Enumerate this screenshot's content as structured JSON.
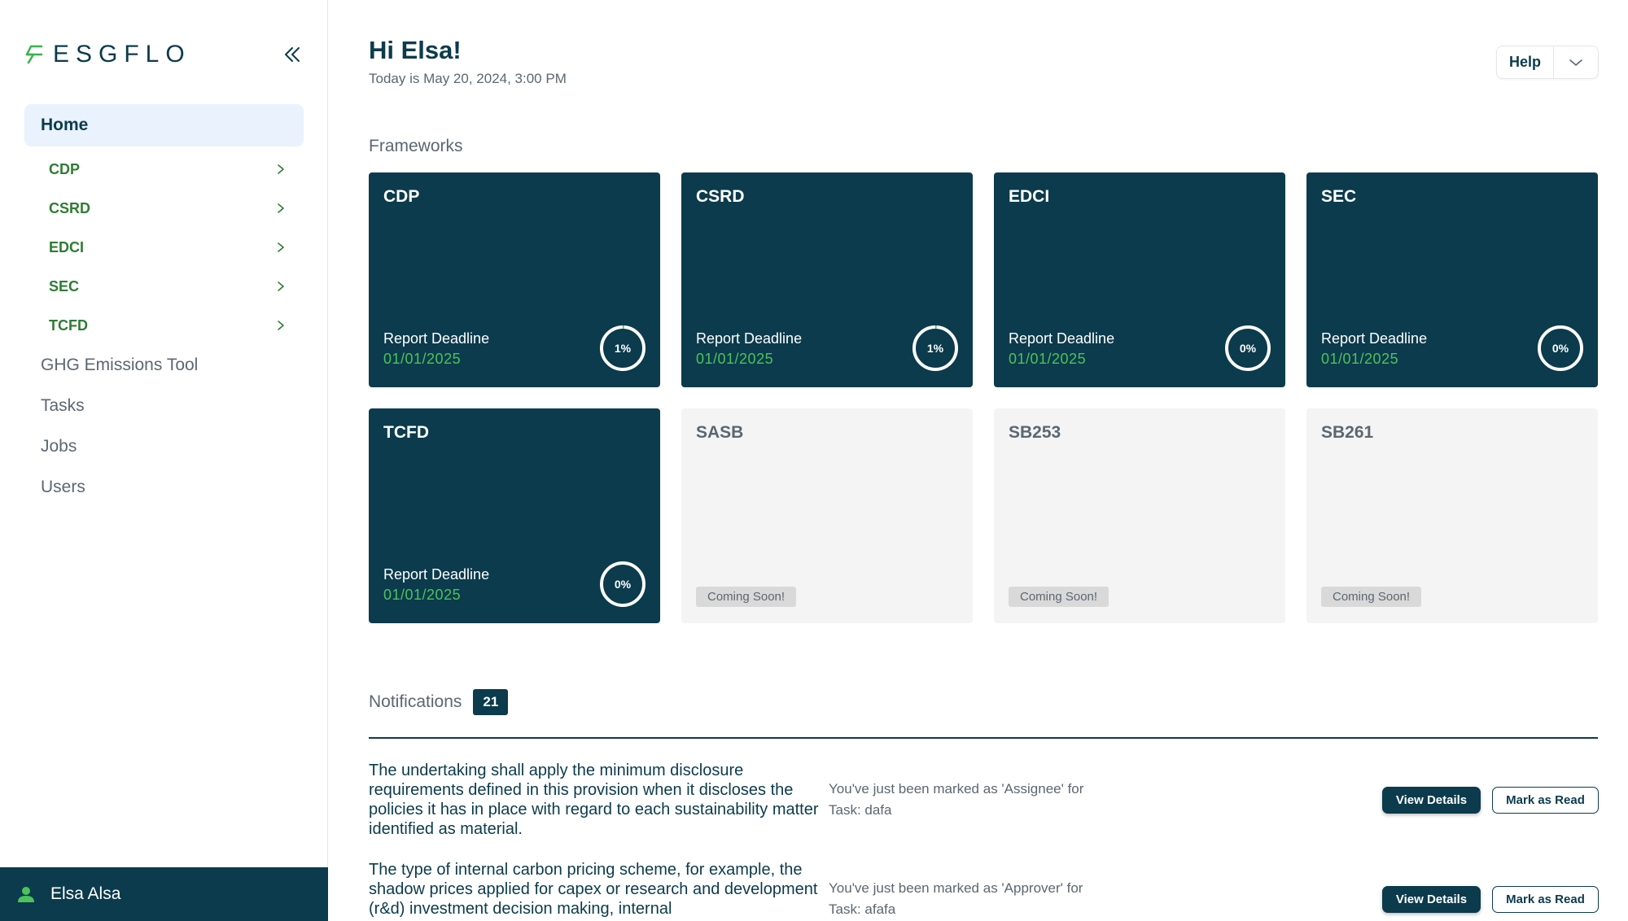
{
  "brand": {
    "logo_text": "ESGFLO",
    "colors": {
      "primary": "#0b3b4c",
      "accent_green": "#37b34a",
      "deadline_green": "#4cc35a",
      "nav_active_bg": "#e9f2fd"
    }
  },
  "sidebar": {
    "home_label": "Home",
    "frameworks": [
      {
        "label": "CDP"
      },
      {
        "label": "CSRD"
      },
      {
        "label": "EDCI"
      },
      {
        "label": "SEC"
      },
      {
        "label": "TCFD"
      }
    ],
    "items": [
      {
        "label": "GHG Emissions Tool"
      },
      {
        "label": "Tasks"
      },
      {
        "label": "Jobs"
      },
      {
        "label": "Users"
      }
    ],
    "user": {
      "name": "Elsa Alsa",
      "icon": "user-icon"
    }
  },
  "header": {
    "greeting": "Hi Elsa!",
    "date": "Today is May 20, 2024, 3:00 PM",
    "help_label": "Help"
  },
  "frameworks": {
    "title": "Frameworks",
    "cards": [
      {
        "name": "CDP",
        "deadline_label": "Report Deadline",
        "deadline": "01/01/2025",
        "progress": 1,
        "progress_label": "1%",
        "status": "active"
      },
      {
        "name": "CSRD",
        "deadline_label": "Report Deadline",
        "deadline": "01/01/2025",
        "progress": 1,
        "progress_label": "1%",
        "status": "active"
      },
      {
        "name": "EDCI",
        "deadline_label": "Report Deadline",
        "deadline": "01/01/2025",
        "progress": 0,
        "progress_label": "0%",
        "status": "active"
      },
      {
        "name": "SEC",
        "deadline_label": "Report Deadline",
        "deadline": "01/01/2025",
        "progress": 0,
        "progress_label": "0%",
        "status": "active"
      },
      {
        "name": "TCFD",
        "deadline_label": "Report Deadline",
        "deadline": "01/01/2025",
        "progress": 0,
        "progress_label": "0%",
        "status": "active"
      },
      {
        "name": "SASB",
        "badge": "Coming Soon!",
        "status": "soon"
      },
      {
        "name": "SB253",
        "badge": "Coming Soon!",
        "status": "soon"
      },
      {
        "name": "SB261",
        "badge": "Coming Soon!",
        "status": "soon"
      }
    ]
  },
  "notifications": {
    "title": "Notifications",
    "count": "21",
    "view_label": "View Details",
    "mark_label": "Mark as Read",
    "items": [
      {
        "text": "The undertaking shall apply the minimum disclosure requirements defined in this provision when it discloses the policies it has in place with regard to each sustainability matter identified as material.",
        "meta_line1": "You've just been marked as 'Assignee' for",
        "meta_line2": "Task: dafa"
      },
      {
        "text": "The type of internal carbon pricing scheme, for example, the shadow prices applied for capex or research and development (r&d) investment decision making, internal",
        "meta_line1": "You've just been marked as 'Approver' for",
        "meta_line2": "Task: afafa"
      }
    ]
  }
}
